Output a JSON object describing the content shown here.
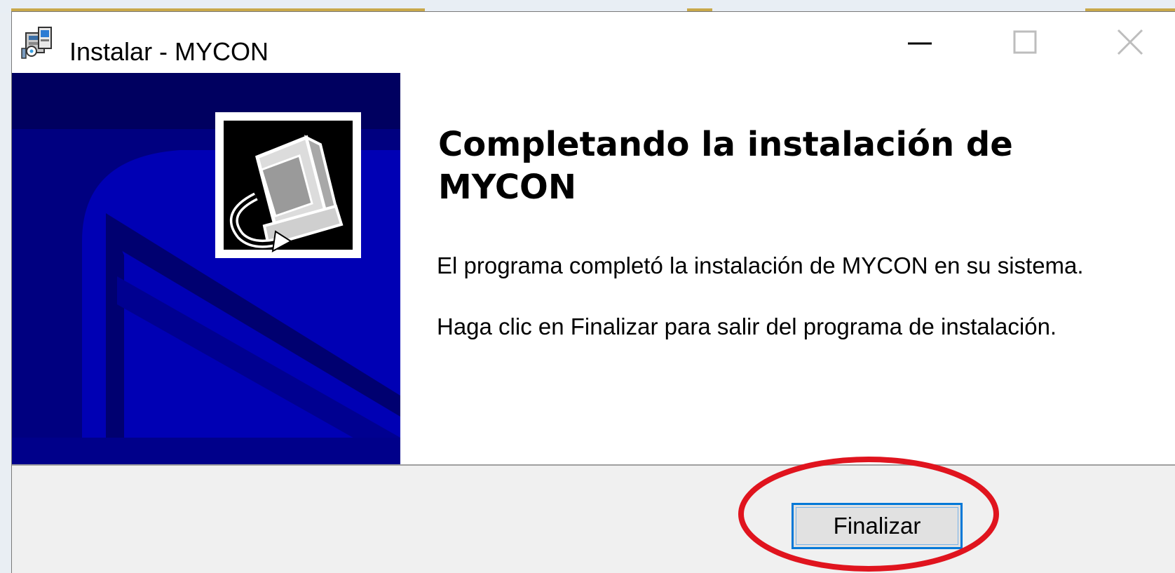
{
  "window": {
    "title": "Instalar - MYCON"
  },
  "titlebar_buttons": {
    "minimize_icon": "minimize-icon",
    "maximize_icon": "maximize-icon",
    "close_icon": "close-icon"
  },
  "content": {
    "heading": "Completando la instalación de MYCON",
    "paragraph_1": "El programa completó la instalación de MYCON en su sistema.",
    "paragraph_2": "Haga clic en Finalizar para salir del programa de instalación."
  },
  "footer": {
    "finish_label": "Finalizar"
  },
  "colors": {
    "banner_background": "#000080",
    "button_focus_border": "#0078d7",
    "annotation_circle": "#e0141e"
  }
}
